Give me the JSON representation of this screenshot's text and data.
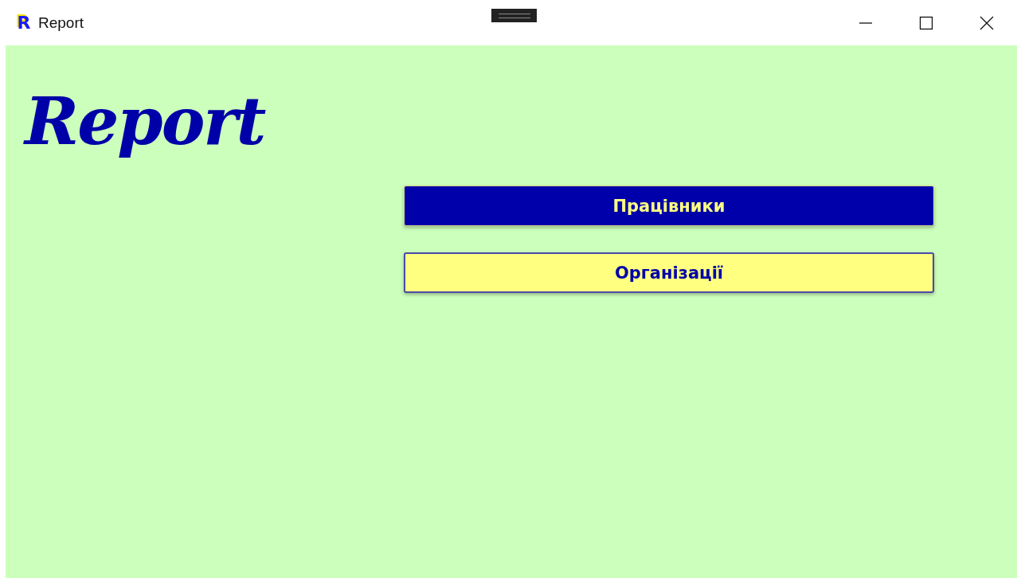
{
  "window": {
    "title": "Report",
    "icon_letter": "R"
  },
  "heading": "Report",
  "buttons": [
    {
      "label": "Працівники",
      "kind": "filled"
    },
    {
      "label": "Організації",
      "kind": "outlined"
    }
  ]
}
